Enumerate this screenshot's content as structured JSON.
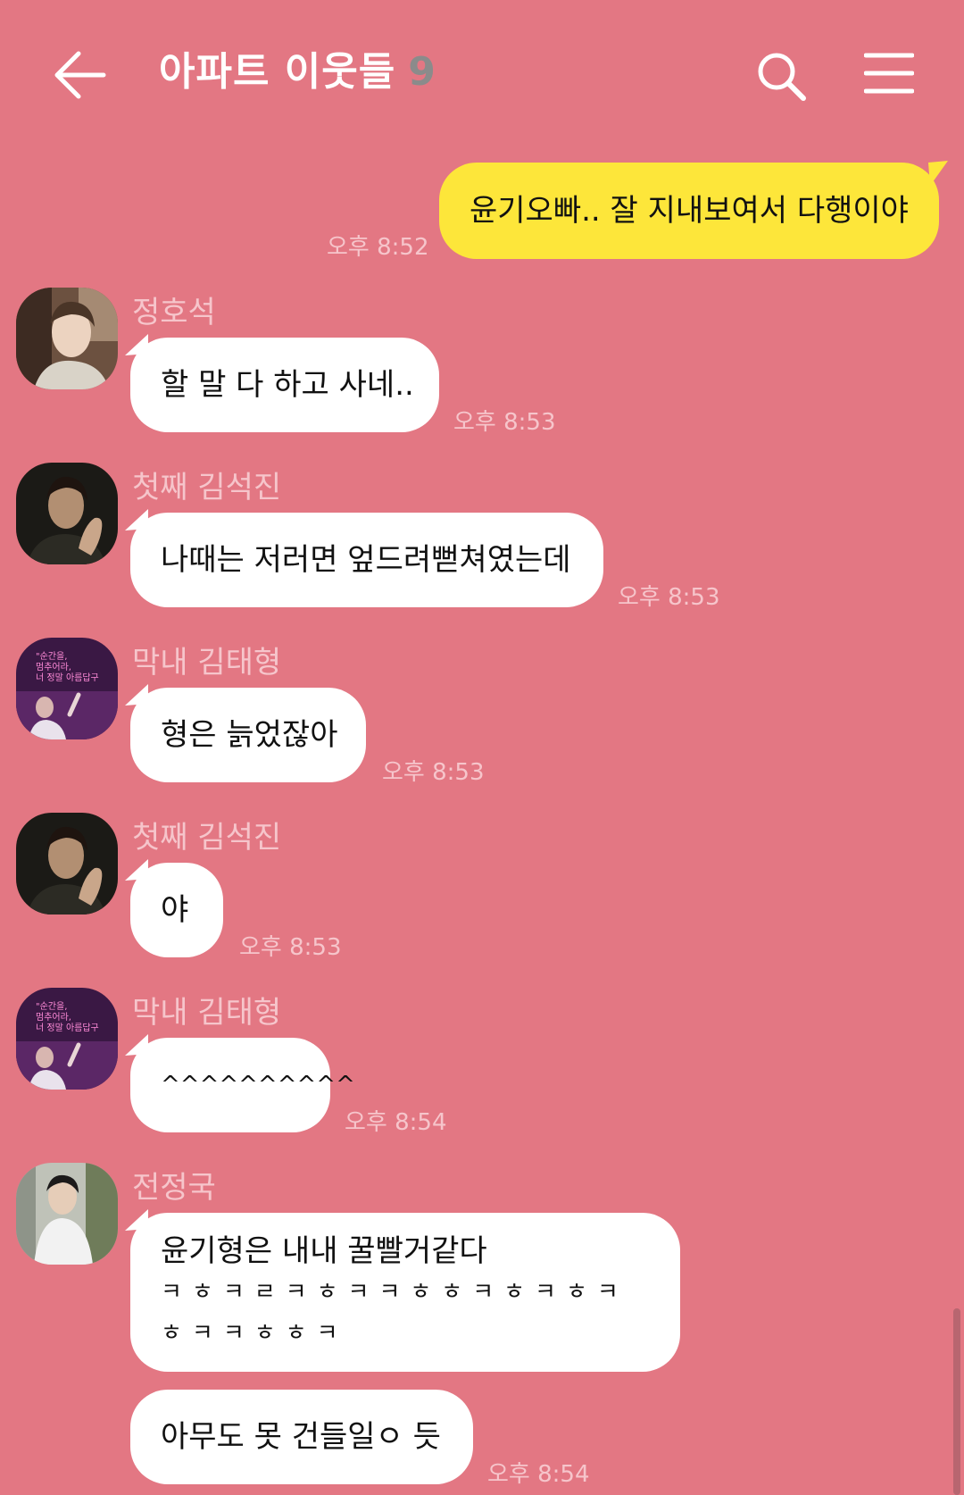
{
  "header": {
    "title": "아파트 이웃들",
    "member_count": "9",
    "back_icon": "arrow-left-icon",
    "search_icon": "search-icon",
    "menu_icon": "hamburger-menu-icon"
  },
  "messages": [
    {
      "sender": "",
      "text": "윤기오빠.. 잘 지내보여서 다행이야",
      "time": "오후 8:52",
      "mine": true
    },
    {
      "sender": "정호석",
      "text": "할 말 다 하고 사네..",
      "time": "오후 8:53"
    },
    {
      "sender": "첫째 김석진",
      "text": "나때는 저러면 엎드려뻗쳐였는데",
      "time": "오후 8:53"
    },
    {
      "sender": "막내 김태형",
      "text": "형은 늙었잖아",
      "time": "오후 8:53"
    },
    {
      "sender": "첫째 김석진",
      "text": "야",
      "time": "오후 8:53"
    },
    {
      "sender": "막내 김태형",
      "text": "^^^^^^^^^^",
      "time": "오후 8:54"
    },
    {
      "sender": "전정국",
      "text": "윤기형은 내내 꿀빨거같다",
      "line2": "ㅋㅎㅋㄹㅋㅎㅋㅋㅎㅎㅋㅎㅋㅎㅋ",
      "line3": "ㅎㅋㅋㅎㅎㅋ"
    },
    {
      "sender": "",
      "text": "아무도 못 건들일ㅇ 듯",
      "time": "오후 8:54"
    }
  ],
  "avatar_sign_text": "순간을, 멈추어라, 너 정말 아름답구",
  "colors": {
    "background": "#e37783",
    "my_bubble": "#fde63a",
    "other_bubble": "#ffffff",
    "meta_text": "#f6c5cb"
  }
}
